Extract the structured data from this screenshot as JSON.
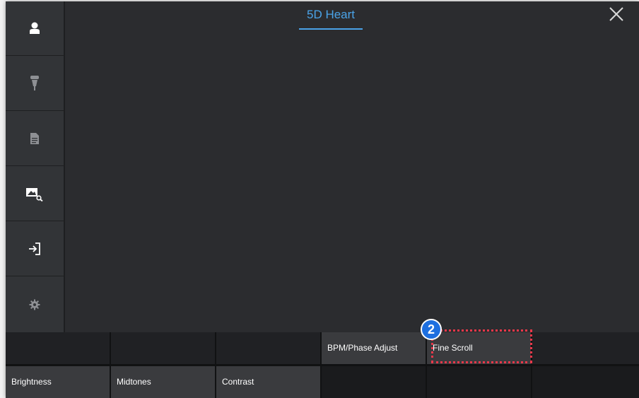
{
  "header": {
    "title": "5D Heart"
  },
  "sidebar": {
    "items": [
      {
        "icon": "patient-icon"
      },
      {
        "icon": "probe-icon"
      },
      {
        "icon": "report-icon"
      },
      {
        "icon": "image-review-icon"
      },
      {
        "icon": "exit-icon"
      },
      {
        "icon": "gear-icon"
      }
    ]
  },
  "controls": {
    "row1": [
      "",
      "",
      "",
      "BPM/Phase Adjust",
      "Fine Scroll",
      ""
    ],
    "row2": [
      "Brightness",
      "Midtones",
      "Contrast",
      "",
      "",
      ""
    ]
  },
  "annotation": {
    "marker": "2"
  },
  "colors": {
    "accent": "#4aa3e8",
    "highlight": "#e8384a",
    "marker": "#1d6fe0"
  }
}
